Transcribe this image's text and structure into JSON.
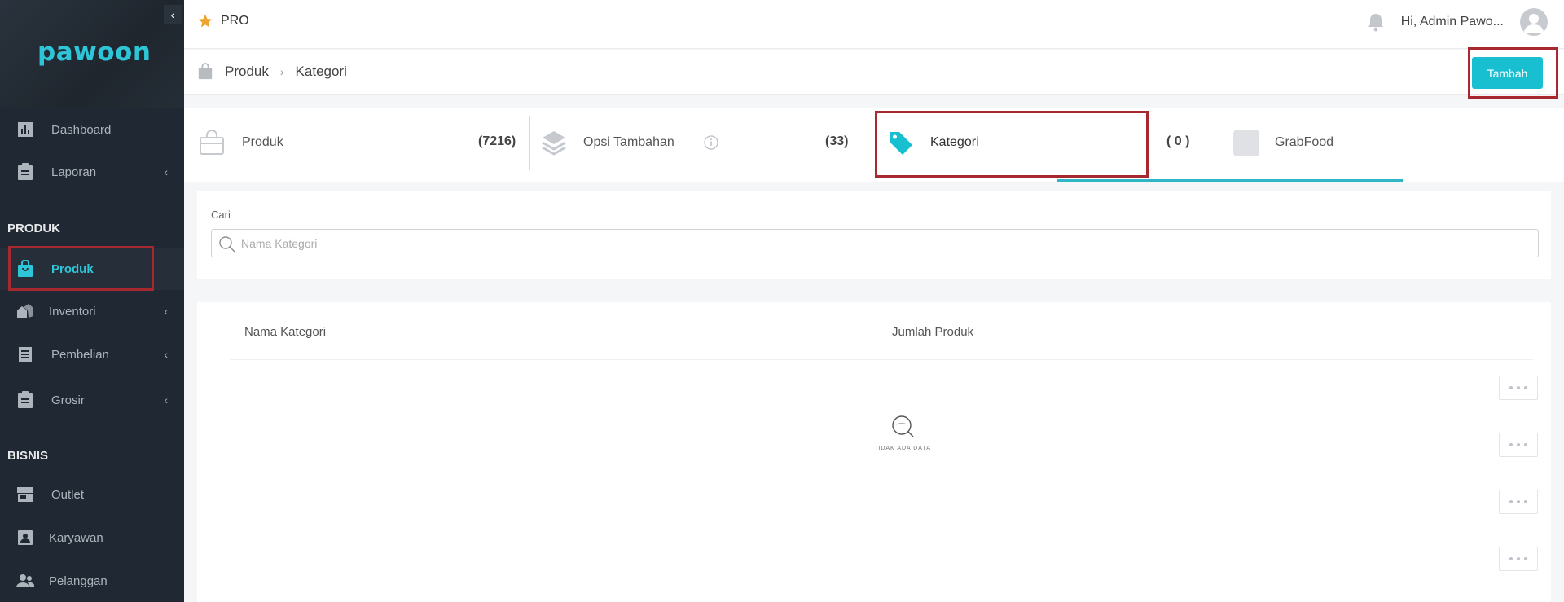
{
  "sidebar": {
    "logo": "pawoon",
    "collapse_glyph": "‹",
    "items_top": [
      {
        "label": "Dashboard",
        "icon": "bar-chart-icon"
      },
      {
        "label": "Laporan",
        "icon": "clipboard-icon",
        "chevron": "‹"
      }
    ],
    "section_produk": "PRODUK",
    "items_produk": [
      {
        "label": "Produk",
        "icon": "shopping-bag-icon",
        "active": true
      },
      {
        "label": "Inventori",
        "icon": "boxes-icon",
        "chevron": "‹"
      },
      {
        "label": "Pembelian",
        "icon": "document-list-icon",
        "chevron": "‹"
      },
      {
        "label": "Grosir",
        "icon": "clipboard-icon",
        "chevron": "‹"
      }
    ],
    "section_bisnis": "BISNIS",
    "items_bisnis": [
      {
        "label": "Outlet",
        "icon": "store-icon"
      },
      {
        "label": "Karyawan",
        "icon": "id-card-icon"
      },
      {
        "label": "Pelanggan",
        "icon": "users-icon"
      }
    ]
  },
  "topbar": {
    "plan": "PRO",
    "greeting": "Hi, Admin Pawo..."
  },
  "breadcrumb": {
    "root": "Produk",
    "separator": "›",
    "current": "Kategori"
  },
  "actions": {
    "add_label": "Tambah"
  },
  "tabs": [
    {
      "label": "Produk",
      "count": "(7216)"
    },
    {
      "label": "Opsi Tambahan",
      "count": "(33)"
    },
    {
      "label": "Kategori",
      "count": "( 0 )",
      "active": true
    },
    {
      "label": "GrabFood",
      "count": ""
    }
  ],
  "search": {
    "label": "Cari",
    "placeholder": "Nama Kategori",
    "value": ""
  },
  "table": {
    "columns": [
      "Nama Kategori",
      "Jumlah Produk"
    ],
    "empty_text": "TIDAK ADA DATA",
    "row_menu_count": 4
  },
  "colors": {
    "accent": "#17bfd0",
    "sidebar_bg": "#1f2833",
    "highlight": "#a8282f",
    "star": "#f0a430"
  }
}
